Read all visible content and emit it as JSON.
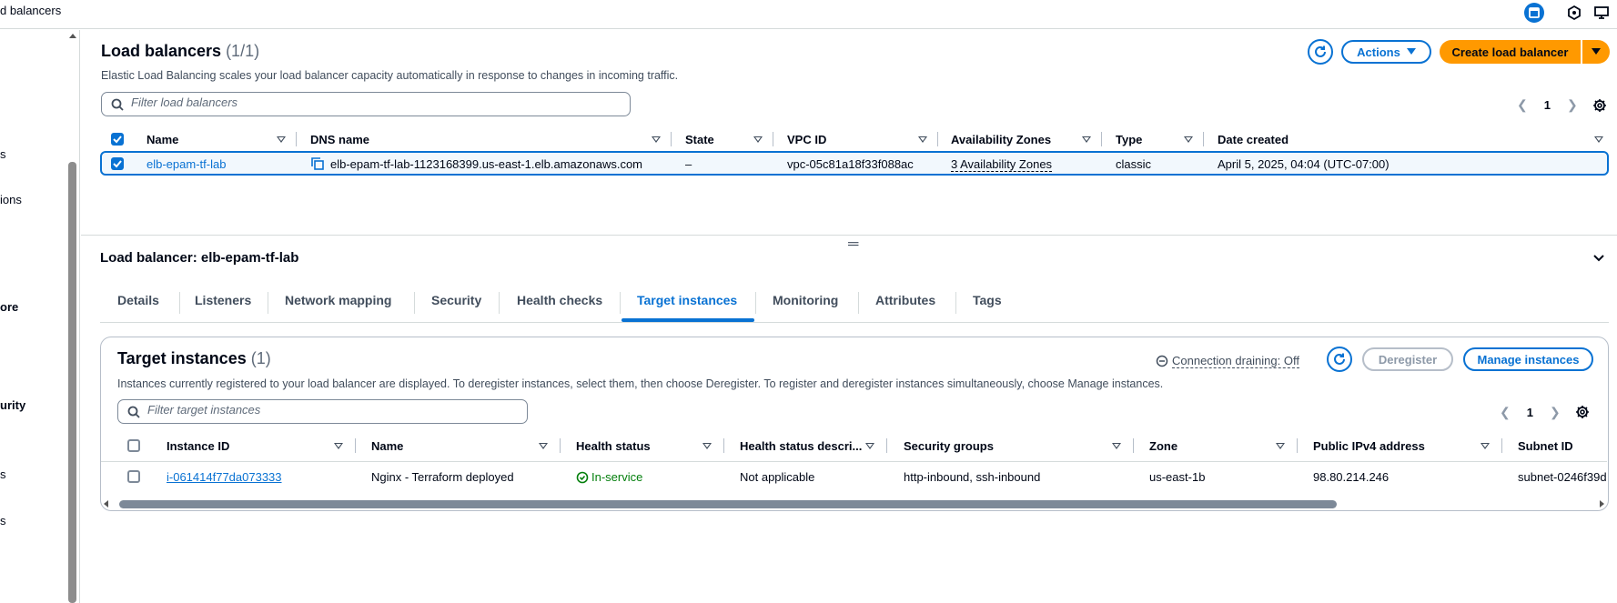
{
  "topbar": {
    "breadcrumb": "d balancers",
    "icons": [
      "cloudshell-icon",
      "notifications-icon",
      "display-icon"
    ]
  },
  "sidebar": {
    "items": [
      {
        "label": "s",
        "bold": false
      },
      {
        "label": "ions",
        "bold": false
      },
      {
        "label": "ore",
        "bold": true
      },
      {
        "label": "urity",
        "bold": true
      },
      {
        "label": "s",
        "bold": false
      },
      {
        "label": "s",
        "bold": false
      }
    ]
  },
  "load_balancers": {
    "title": "Load balancers",
    "count": "(1/1)",
    "description": "Elastic Load Balancing scales your load balancer capacity automatically in response to changes in incoming traffic.",
    "actions_label": "Actions",
    "create_label": "Create load balancer",
    "search_placeholder": "Filter load balancers",
    "page": "1",
    "columns": [
      "Name",
      "DNS name",
      "State",
      "VPC ID",
      "Availability Zones",
      "Type",
      "Date created"
    ],
    "row": {
      "name": "elb-epam-tf-lab",
      "dns": "elb-epam-tf-lab-1123168399.us-east-1.elb.amazonaws.com",
      "state": "–",
      "vpc": "vpc-05c81a18f33f088ac",
      "zones": "3 Availability Zones",
      "type": "classic",
      "date": "April 5, 2025, 04:04 (UTC-07:00)"
    }
  },
  "detail": {
    "title": "Load balancer: elb-epam-tf-lab",
    "tabs": [
      "Details",
      "Listeners",
      "Network mapping",
      "Security",
      "Health checks",
      "Target instances",
      "Monitoring",
      "Attributes",
      "Tags"
    ],
    "active_tab": "Target instances"
  },
  "targets": {
    "title": "Target instances",
    "count": "(1)",
    "description": "Instances currently registered to your load balancer are displayed. To deregister instances, select them, then choose Deregister. To register and deregister instances simultaneously, choose Manage instances.",
    "draining": "Connection draining: Off",
    "deregister_label": "Deregister",
    "manage_label": "Manage instances",
    "search_placeholder": "Filter target instances",
    "page": "1",
    "columns": [
      "Instance ID",
      "Name",
      "Health status",
      "Health status descri...",
      "Security groups",
      "Zone",
      "Public IPv4 address",
      "Subnet ID"
    ],
    "row": {
      "instance_id": "i-061414f77da073333",
      "name": "Nginx - Terraform deployed",
      "health": "In-service",
      "health_desc": "Not applicable",
      "security_groups": "http-inbound, ssh-inbound",
      "zone": "us-east-1b",
      "ipv4": "98.80.214.246",
      "subnet": "subnet-0246f39d"
    }
  },
  "colors": {
    "accent": "#0972d3",
    "primary_button": "#ff9900",
    "success": "#037f0c"
  }
}
